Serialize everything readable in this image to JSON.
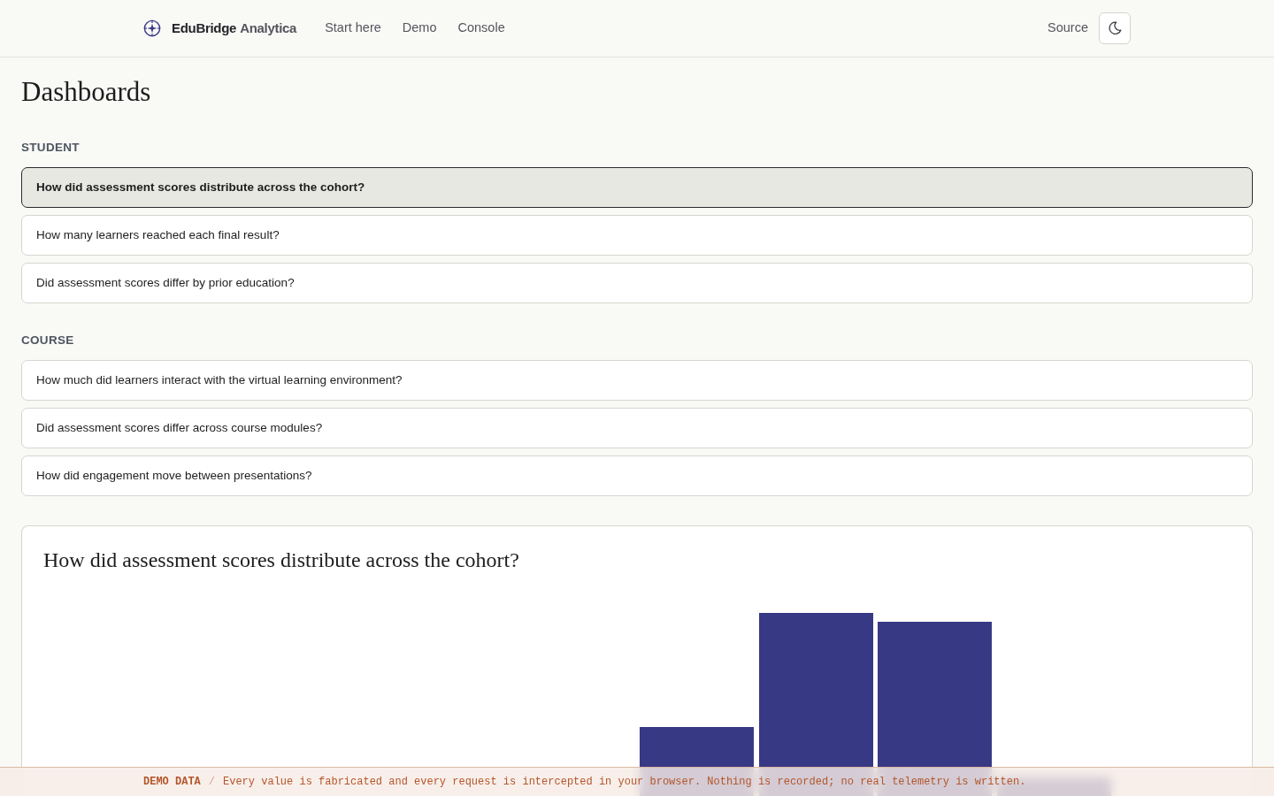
{
  "navbar": {
    "brand": {
      "name": "EduBridge",
      "suffix": "Analytica"
    },
    "links": [
      {
        "label": "Start here"
      },
      {
        "label": "Demo"
      },
      {
        "label": "Console"
      }
    ],
    "source_link": "Source"
  },
  "page_title": "Dashboards",
  "sections": [
    {
      "heading": "STUDENT",
      "items": [
        {
          "label": "How did assessment scores distribute across the cohort?",
          "selected": true
        },
        {
          "label": "How many learners reached each final result?",
          "selected": false
        },
        {
          "label": "Did assessment scores differ by prior education?",
          "selected": false
        }
      ]
    },
    {
      "heading": "COURSE",
      "items": [
        {
          "label": "How much did learners interact with the virtual learning environment?",
          "selected": false
        },
        {
          "label": "Did assessment scores differ across course modules?",
          "selected": false
        },
        {
          "label": "How did engagement move between presentations?",
          "selected": false
        }
      ]
    }
  ],
  "chart_panel": {
    "title": "How did assessment scores distribute across the cohort?"
  },
  "banner": {
    "tag": "DEMO DATA",
    "separator": "/",
    "message": "Every value is fabricated and every request is intercepted in your browser. Nothing is recorded; no real telemetry is written."
  }
}
